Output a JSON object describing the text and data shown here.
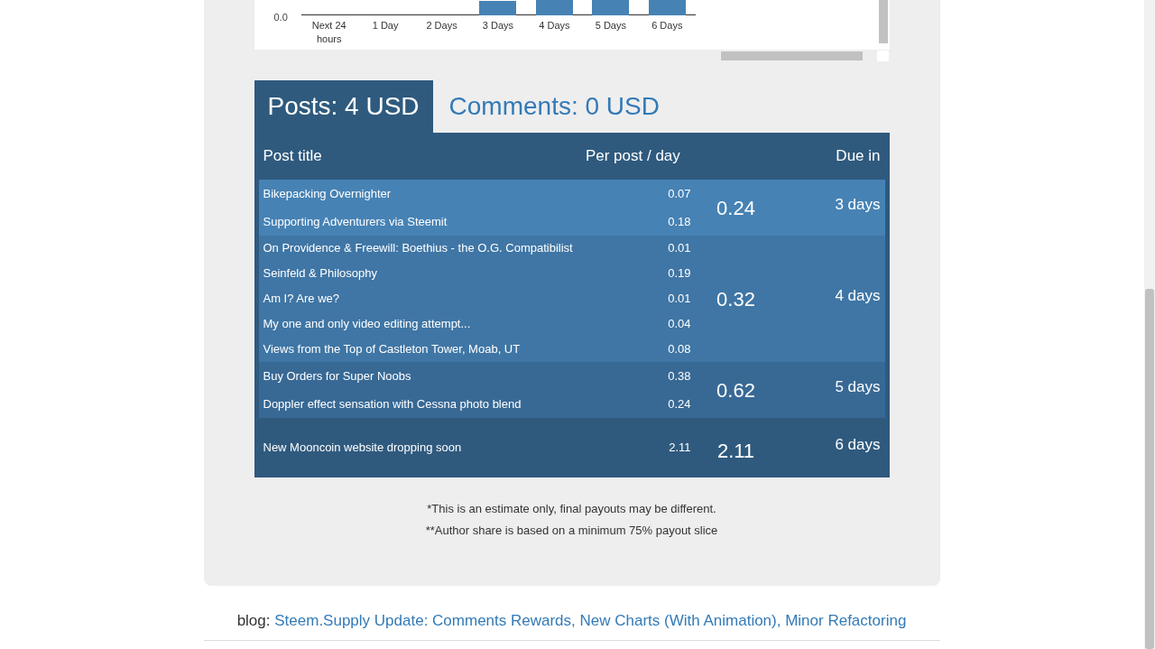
{
  "chart": {
    "y_tick": "0.0",
    "x_labels": [
      "Next 24 hours",
      "1 Day",
      "2 Days",
      "3 Days",
      "4 Days",
      "5 Days",
      "6 Days"
    ]
  },
  "tabs": [
    {
      "label": "Posts: 4 USD",
      "selected": true
    },
    {
      "label": "Comments: 0 USD",
      "selected": false
    }
  ],
  "table": {
    "columns": [
      "Post title",
      "Per post / day",
      "Due in"
    ],
    "groups": [
      {
        "color": "#4682b4",
        "total": "0.24",
        "due": "3 days",
        "rows": [
          {
            "title": "Bikepacking Overnighter",
            "value": "0.07"
          },
          {
            "title": "Supporting Adventurers via Steemit",
            "value": "0.18"
          }
        ]
      },
      {
        "color": "#3f76a5",
        "total": "0.32",
        "due": "4 days",
        "rows": [
          {
            "title": "On Providence & Freewill: Boethius - the O.G. Compatibilist",
            "value": "0.01"
          },
          {
            "title": "Seinfeld & Philosophy",
            "value": "0.19"
          },
          {
            "title": "Am I? Are we?",
            "value": "0.01"
          },
          {
            "title": "My one and only video editing attempt...",
            "value": "0.04"
          },
          {
            "title": "Views from the Top of Castleton Tower, Moab, UT",
            "value": "0.08"
          }
        ]
      },
      {
        "color": "#386995",
        "total": "0.62",
        "due": "5 days",
        "rows": [
          {
            "title": "Buy Orders for Super Noobs",
            "value": "0.38"
          },
          {
            "title": "Doppler effect sensation with Cessna photo blend",
            "value": "0.24"
          }
        ]
      },
      {
        "color": "#2f5a7e",
        "total": "2.11",
        "due": "6 days",
        "rows": [
          {
            "title": "New Mooncoin website dropping soon",
            "value": "2.11"
          }
        ]
      }
    ]
  },
  "notes": [
    "*This is an estimate only, final payouts may be different.",
    "**Author share is based on a minimum 75% payout slice"
  ],
  "blog": {
    "label": "blog:",
    "link": "Steem.Supply Update: Comments Rewards, New Charts (With Animation), Minor Refactoring"
  }
}
